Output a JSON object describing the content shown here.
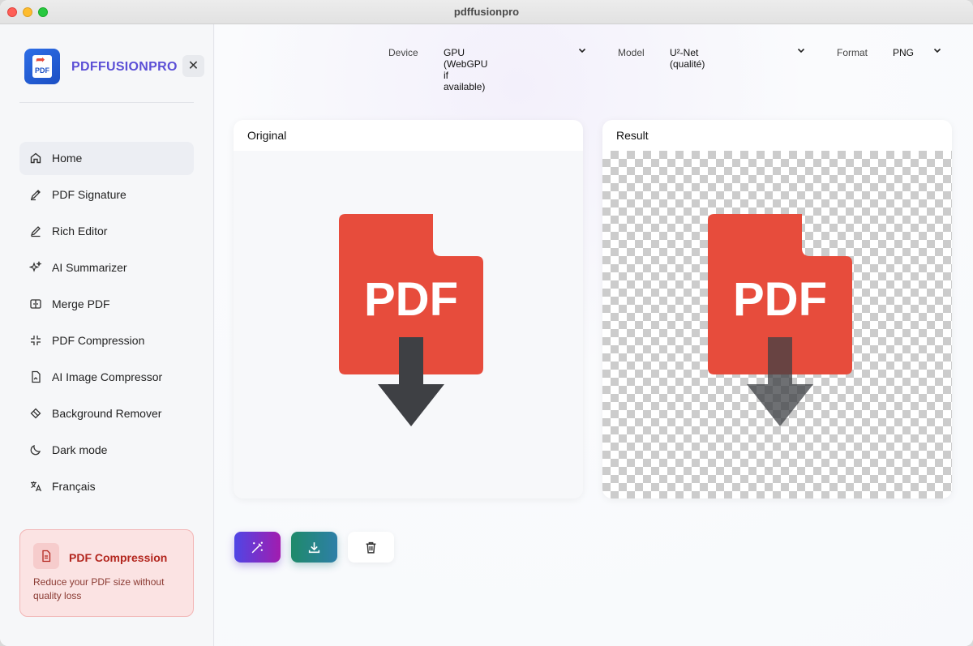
{
  "window": {
    "title": "pdffusionpro"
  },
  "sidebar": {
    "brand": "PDFFUSIONPRO",
    "logo_text": "PDF",
    "close_label": "✕",
    "items": [
      {
        "label": "Home",
        "icon": "home-icon",
        "active": true
      },
      {
        "label": "PDF Signature",
        "icon": "signature-icon",
        "active": false
      },
      {
        "label": "Rich Editor",
        "icon": "pencil-icon",
        "active": false
      },
      {
        "label": "AI Summarizer",
        "icon": "sparkles-icon",
        "active": false
      },
      {
        "label": "Merge PDF",
        "icon": "merge-icon",
        "active": false
      },
      {
        "label": "PDF Compression",
        "icon": "compress-icon",
        "active": false
      },
      {
        "label": "AI Image Compressor",
        "icon": "image-file-icon",
        "active": false
      },
      {
        "label": "Background Remover",
        "icon": "eraser-icon",
        "active": false
      },
      {
        "label": "Dark mode",
        "icon": "moon-icon",
        "active": false
      },
      {
        "label": "Français",
        "icon": "language-icon",
        "active": false
      }
    ],
    "promo": {
      "title": "PDF Compression",
      "description": "Reduce your PDF size without quality loss",
      "icon": "document-icon"
    }
  },
  "toolbar": {
    "device_label": "Device",
    "device_value": "GPU (WebGPU if available)",
    "model_label": "Model",
    "model_value": "U²-Net (qualité)",
    "format_label": "Format",
    "format_value": "PNG"
  },
  "panels": {
    "original_title": "Original",
    "result_title": "Result",
    "image_text": "PDF"
  },
  "actions": {
    "magic": "magic-wand-icon",
    "download": "download-icon",
    "delete": "trash-icon"
  },
  "colors": {
    "brand": "#5b4fd6",
    "pdf_red": "#e74c3c",
    "promo_text": "#b3261e"
  }
}
